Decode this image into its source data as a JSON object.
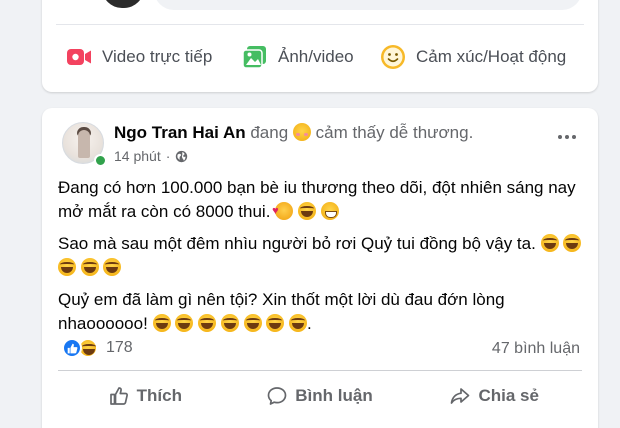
{
  "composer": {
    "actions": [
      {
        "label": "Video trực tiếp",
        "icon": "live-video-icon",
        "color": "#f3425f"
      },
      {
        "label": "Ảnh/video",
        "icon": "photo-icon",
        "color": "#45bd62"
      },
      {
        "label": "Cảm xúc/Hoạt động",
        "icon": "feeling-icon",
        "color": "#f7b928"
      }
    ]
  },
  "post": {
    "author": "Ngo Tran Hai An",
    "feeling_prefix": "đang",
    "feeling_text": "cảm thấy dễ thương.",
    "time": "14 phút",
    "separator": "·",
    "privacy_icon": "globe-icon",
    "paragraphs": [
      "Đang có hơn 100.000 bạn bè iu thương theo dõi, đột nhiên sáng nay mở mắt ra còn có 8000 thui.",
      "Sao mà sau một đêm nhìu người bỏ rơi Quỷ tui đồng bộ vậy ta.",
      "Quỷ em đã làm gì nên tội? Xin thốt một lời dù đau đớn lòng nhaoooooo!"
    ],
    "paragraph_end": ".",
    "reaction_count": "178",
    "comment_count": "47 bình luận",
    "actions": {
      "like": "Thích",
      "comment": "Bình luận",
      "share": "Chia sẻ"
    }
  },
  "colors": {
    "accent": "#1877f2",
    "online": "#31a24c",
    "secondary_text": "#65676b"
  }
}
